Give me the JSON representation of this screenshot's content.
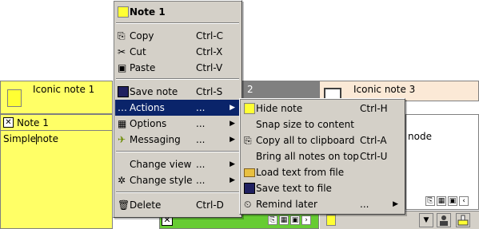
{
  "notes": {
    "iconic1": {
      "label": "Iconic note 1"
    },
    "iconic2": {
      "label": "2"
    },
    "iconic3": {
      "label": "Iconic note 3"
    },
    "note1": {
      "title": "Note 1",
      "text_before_cursor": "Simple",
      "text_after_cursor": "note"
    },
    "note_right_partial": {
      "text": "node"
    }
  },
  "context_menu": {
    "header": "Note 1",
    "items": [
      {
        "label": "Copy",
        "shortcut": "Ctrl-C",
        "icon": "copy-icon"
      },
      {
        "label": "Cut",
        "shortcut": "Ctrl-X",
        "icon": "cut-icon"
      },
      {
        "label": "Paste",
        "shortcut": "Ctrl-V",
        "icon": "paste-icon"
      },
      {
        "label": "Save note",
        "shortcut": "Ctrl-S",
        "icon": "save-icon"
      },
      {
        "label": "Actions",
        "shortcut": "...",
        "icon": "dots-icon",
        "selected": true
      },
      {
        "label": "Options",
        "shortcut": "...",
        "icon": "options-icon"
      },
      {
        "label": "Messaging",
        "shortcut": "...",
        "icon": "messaging-icon"
      },
      {
        "label": "Change view",
        "shortcut": "...",
        "icon": ""
      },
      {
        "label": "Change style",
        "shortcut": "...",
        "icon": "style-icon"
      },
      {
        "label": "Delete",
        "shortcut": "Ctrl-D",
        "icon": "delete-icon"
      }
    ]
  },
  "actions_submenu": {
    "items": [
      {
        "label": "Hide note",
        "shortcut": "Ctrl-H",
        "icon": "note-icon"
      },
      {
        "label": "Snap size to content",
        "shortcut": "",
        "icon": ""
      },
      {
        "label": "Copy all to clipboard",
        "shortcut": "Ctrl-A",
        "icon": "copy-icon"
      },
      {
        "label": "Bring all notes on top",
        "shortcut": "Ctrl-U",
        "icon": ""
      },
      {
        "label": "Load text from file",
        "shortcut": "",
        "icon": "folder-icon"
      },
      {
        "label": "Save text to file",
        "shortcut": "",
        "icon": "save-icon"
      },
      {
        "label": "Remind later",
        "shortcut": "...",
        "icon": "clock-icon"
      }
    ]
  },
  "colors": {
    "note_yellow": "#ffff66",
    "note_peach": "#fbe9d6",
    "menu_bg": "#d4d0c8",
    "selection": "#0a246a",
    "note_green": "#66cc33"
  }
}
